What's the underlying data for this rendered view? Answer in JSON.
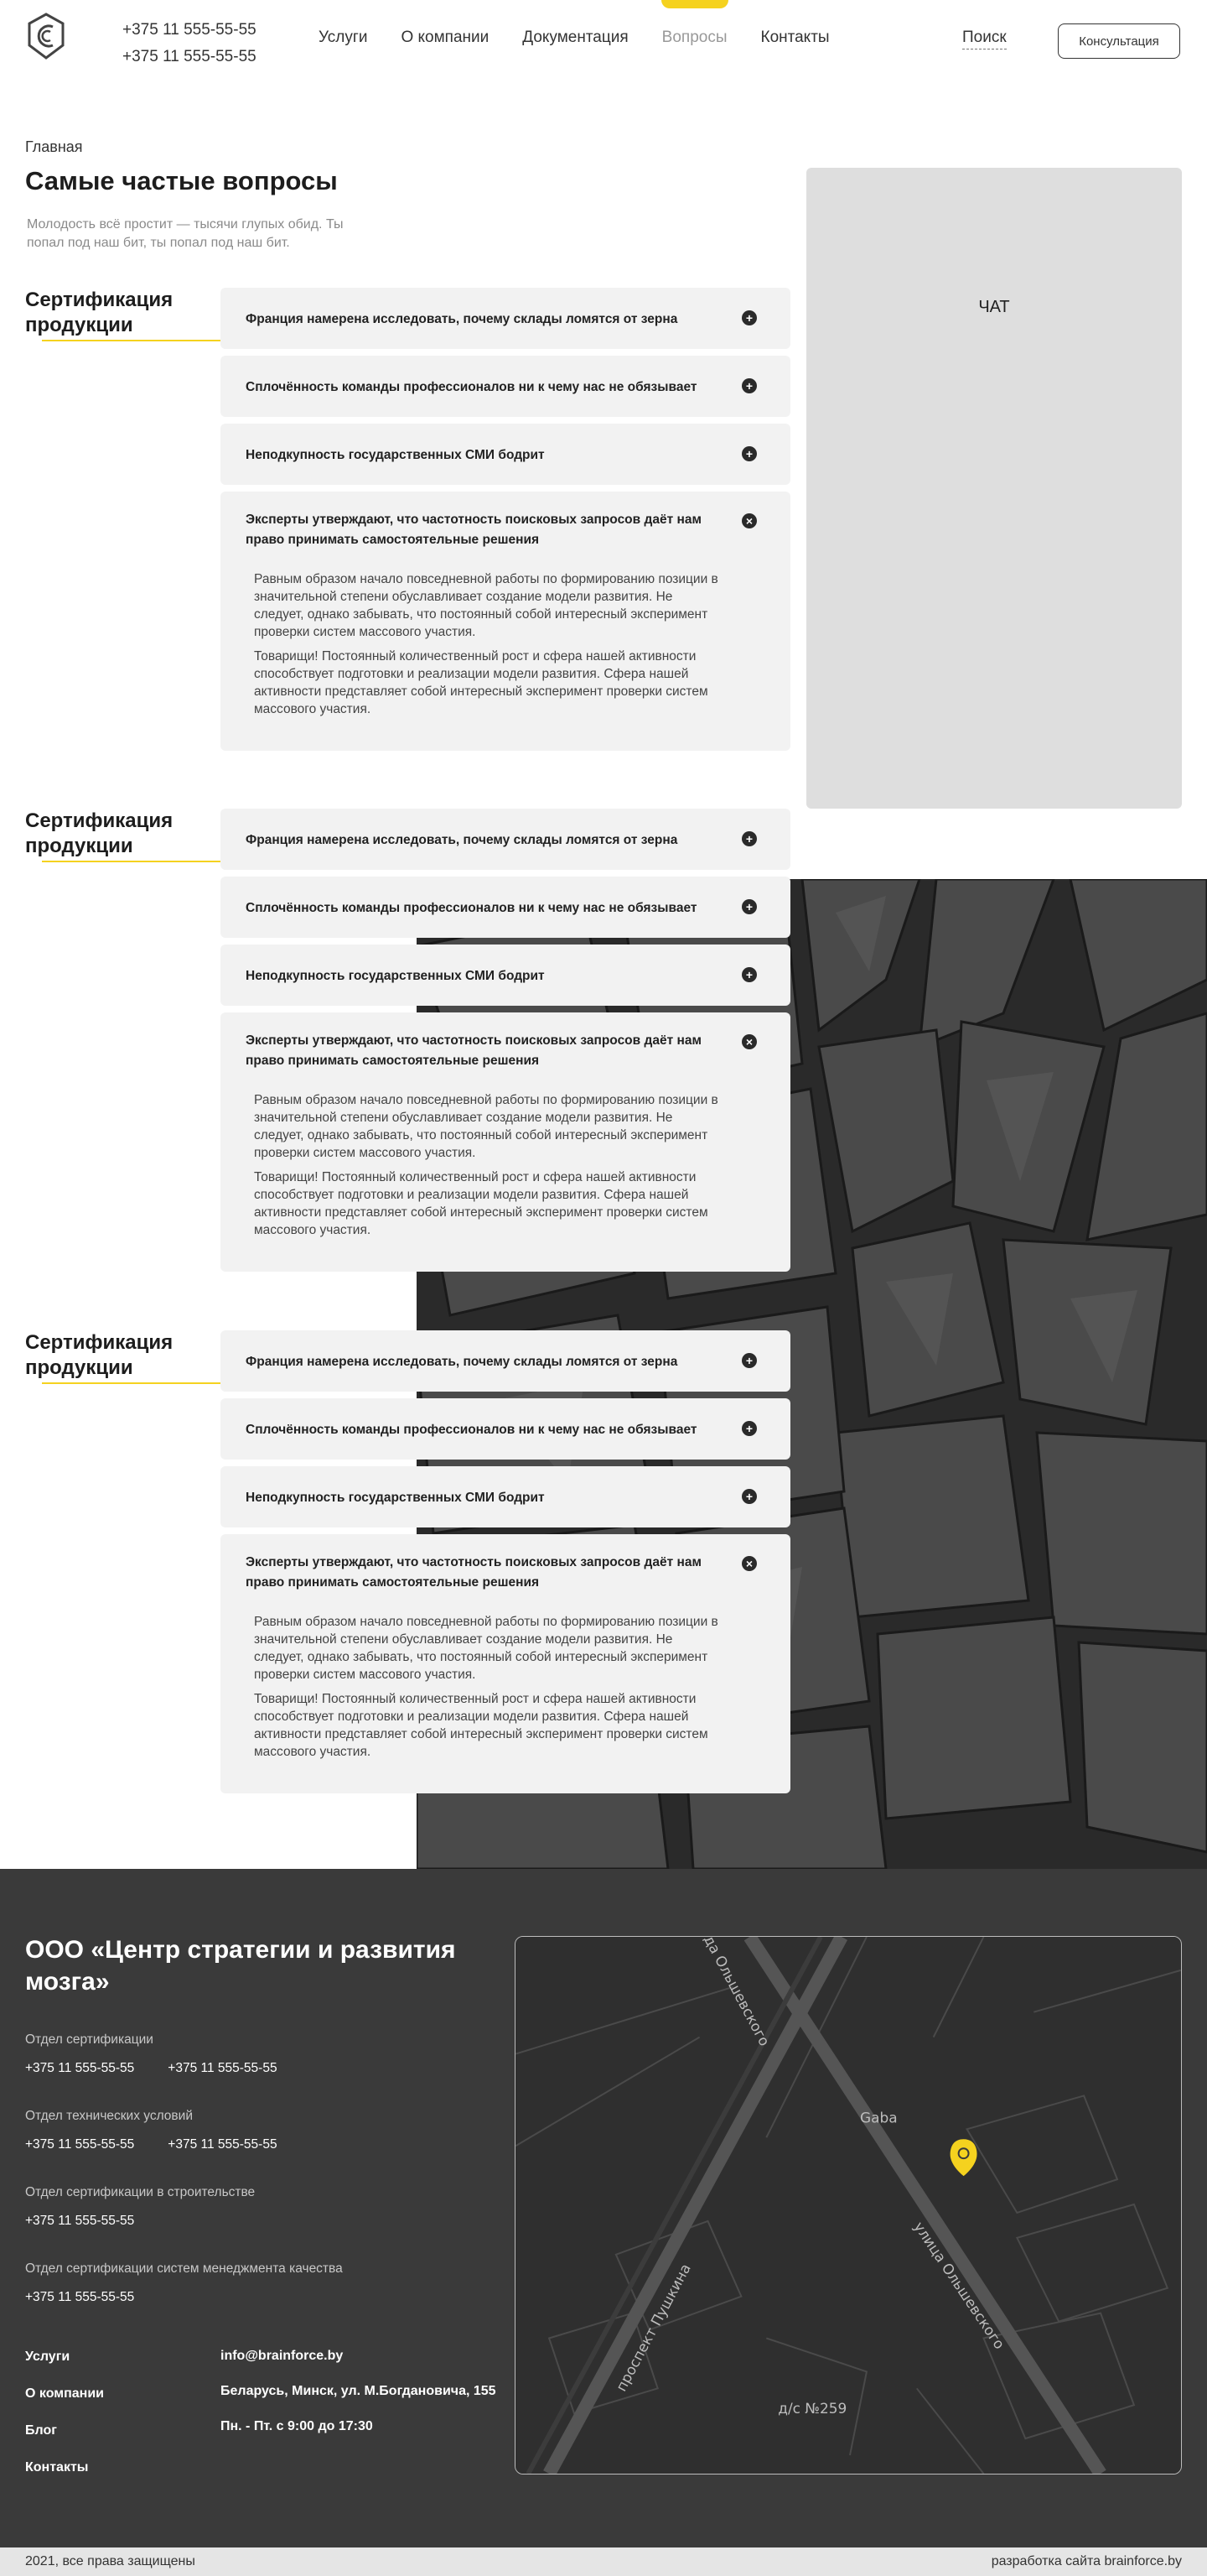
{
  "header": {
    "phones": [
      "+375 11 555-55-55",
      "+375 11 555-55-55"
    ],
    "nav": [
      "Услуги",
      "О компании",
      "Документация",
      "Вопросы",
      "Контакты"
    ],
    "search_label": "Поиск",
    "consult_label": "Консультация"
  },
  "intro": {
    "breadcrumb": "Главная",
    "title": "Самые частые вопросы",
    "lead": "Молодость всё простит — тысячи глупых обид. Ты попал под наш бит, ты попал под наш бит."
  },
  "chat": {
    "label": "ЧАТ"
  },
  "sections": [
    {
      "title": "Сертификация продукции",
      "items": [
        {
          "q": "Франция намерена исследовать, почему склады ломятся от зерна",
          "toggle": "+"
        },
        {
          "q": "Сплочённость команды профессионалов ни к чему нас не обязывает",
          "toggle": "+"
        },
        {
          "q": "Неподкупность государственных СМИ бодрит",
          "toggle": "+"
        },
        {
          "q": "Эксперты утверждают, что частотность поисковых запросов даёт нам право принимать самостоятельные решения",
          "toggle": "×",
          "a": [
            "Равным образом начало повседневной работы по формированию позиции в значительной степени обуславливает создание модели развития. Не следует, однако забывать, что постоянный собой интересный эксперимент проверки систем массового участия.",
            "Товарищи! Постоянный количественный рост и сфера нашей активности способствует подготовки и реализации модели развития. Сфера нашей активности представляет собой интересный эксперимент проверки систем массового участия."
          ]
        }
      ]
    },
    {
      "title": "Сертификация продукции",
      "items": [
        {
          "q": "Франция намерена исследовать, почему склады ломятся от зерна",
          "toggle": "+"
        },
        {
          "q": "Сплочённость команды профессионалов ни к чему нас не обязывает",
          "toggle": "+"
        },
        {
          "q": "Неподкупность государственных СМИ бодрит",
          "toggle": "+"
        },
        {
          "q": "Эксперты утверждают, что частотность поисковых запросов даёт нам право принимать самостоятельные решения",
          "toggle": "×",
          "a": [
            "Равным образом начало повседневной работы по формированию позиции в значительной степени обуславливает создание модели развития. Не следует, однако забывать, что постоянный собой интересный эксперимент проверки систем массового участия.",
            " Товарищи! Постоянный количественный рост и сфера нашей активности способствует подготовки и реализации модели развития. Сфера нашей активности представляет собой интересный эксперимент проверки систем массового участия."
          ]
        }
      ]
    },
    {
      "title": "Сертификация продукции",
      "items": [
        {
          "q": "Франция намерена исследовать, почему склады ломятся от зерна",
          "toggle": "+"
        },
        {
          "q": "Сплочённость команды профессионалов ни к чему нас не обязывает",
          "toggle": "+"
        },
        {
          "q": "Неподкупность государственных СМИ бодрит",
          "toggle": "+"
        },
        {
          "q": "Эксперты утверждают, что частотность поисковых запросов даёт нам право принимать самостоятельные решения",
          "toggle": "×",
          "a": [
            "Равным образом начало повседневной работы по формированию позиции в значительной степени обуславливает создание модели развития. Не следует, однако забывать, что постоянный собой интересный эксперимент проверки систем массового участия.",
            " Товарищи! Постоянный количественный рост и сфера нашей активности способствует подготовки и реализации модели развития. Сфера нашей активности представляет собой интересный эксперимент проверки систем массового участия."
          ]
        }
      ]
    }
  ],
  "footer": {
    "company": "ООО «Центр стратегии и развития мозга»",
    "departments": [
      {
        "name": "Отдел сертификации",
        "phones": [
          "+375 11 555-55-55",
          "+375 11 555-55-55"
        ]
      },
      {
        "name": "Отдел технических условий",
        "phones": [
          "+375 11 555-55-55",
          "+375 11 555-55-55"
        ]
      },
      {
        "name": "Отдел сертификации в строительстве",
        "phones": [
          "+375 11 555-55-55"
        ]
      },
      {
        "name": "Отдел сертификации систем менеджмента качества",
        "phones": [
          "+375 11 555-55-55"
        ]
      }
    ],
    "nav": [
      "Услуги",
      "О компании",
      "Блог",
      "Контакты"
    ],
    "email": "info@brainforce.by",
    "address": "Беларусь, Минск, ул. М.Богдановича, 155",
    "hours": "Пн. - Пт. с 9:00 до 17:30",
    "map_labels": {
      "street_top": "да Ольшевского",
      "street_right": "улица Ольшевского",
      "avenue": "проспект Пушкина",
      "poi": "Gaba",
      "kindergarten": "д/с №259"
    },
    "copyright": "2021, все права защищены",
    "developer": "разработка сайта brainforce.by"
  },
  "colors": {
    "accent": "#f5d21f",
    "footer_bg": "#3a3a3a",
    "faq_bg": "#f2f2f2"
  }
}
